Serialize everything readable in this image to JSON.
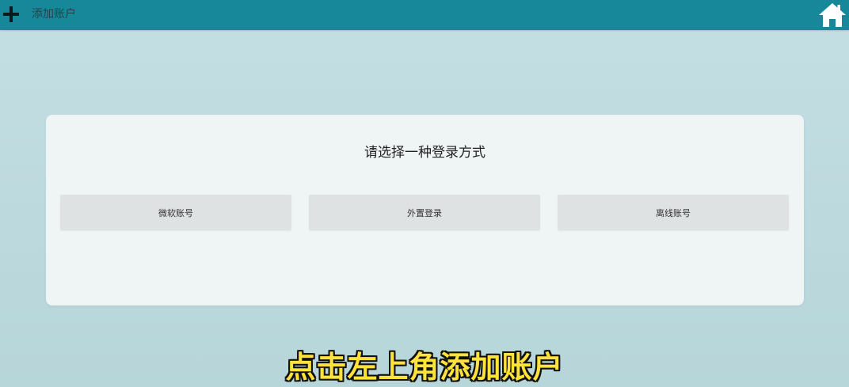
{
  "header": {
    "title": "添加账户",
    "add_icon": "plus-icon",
    "home_icon": "home-icon",
    "bar_color": "#17879a"
  },
  "dialog": {
    "prompt": "请选择一种登录方式",
    "options": [
      {
        "label": "微软账号"
      },
      {
        "label": "外置登录"
      },
      {
        "label": "离线账号"
      }
    ]
  },
  "subtitle": "点击左上角添加账户",
  "colors": {
    "subtitle": "#ffe23a",
    "background": "#bddade",
    "panel": "#eff4f5"
  }
}
